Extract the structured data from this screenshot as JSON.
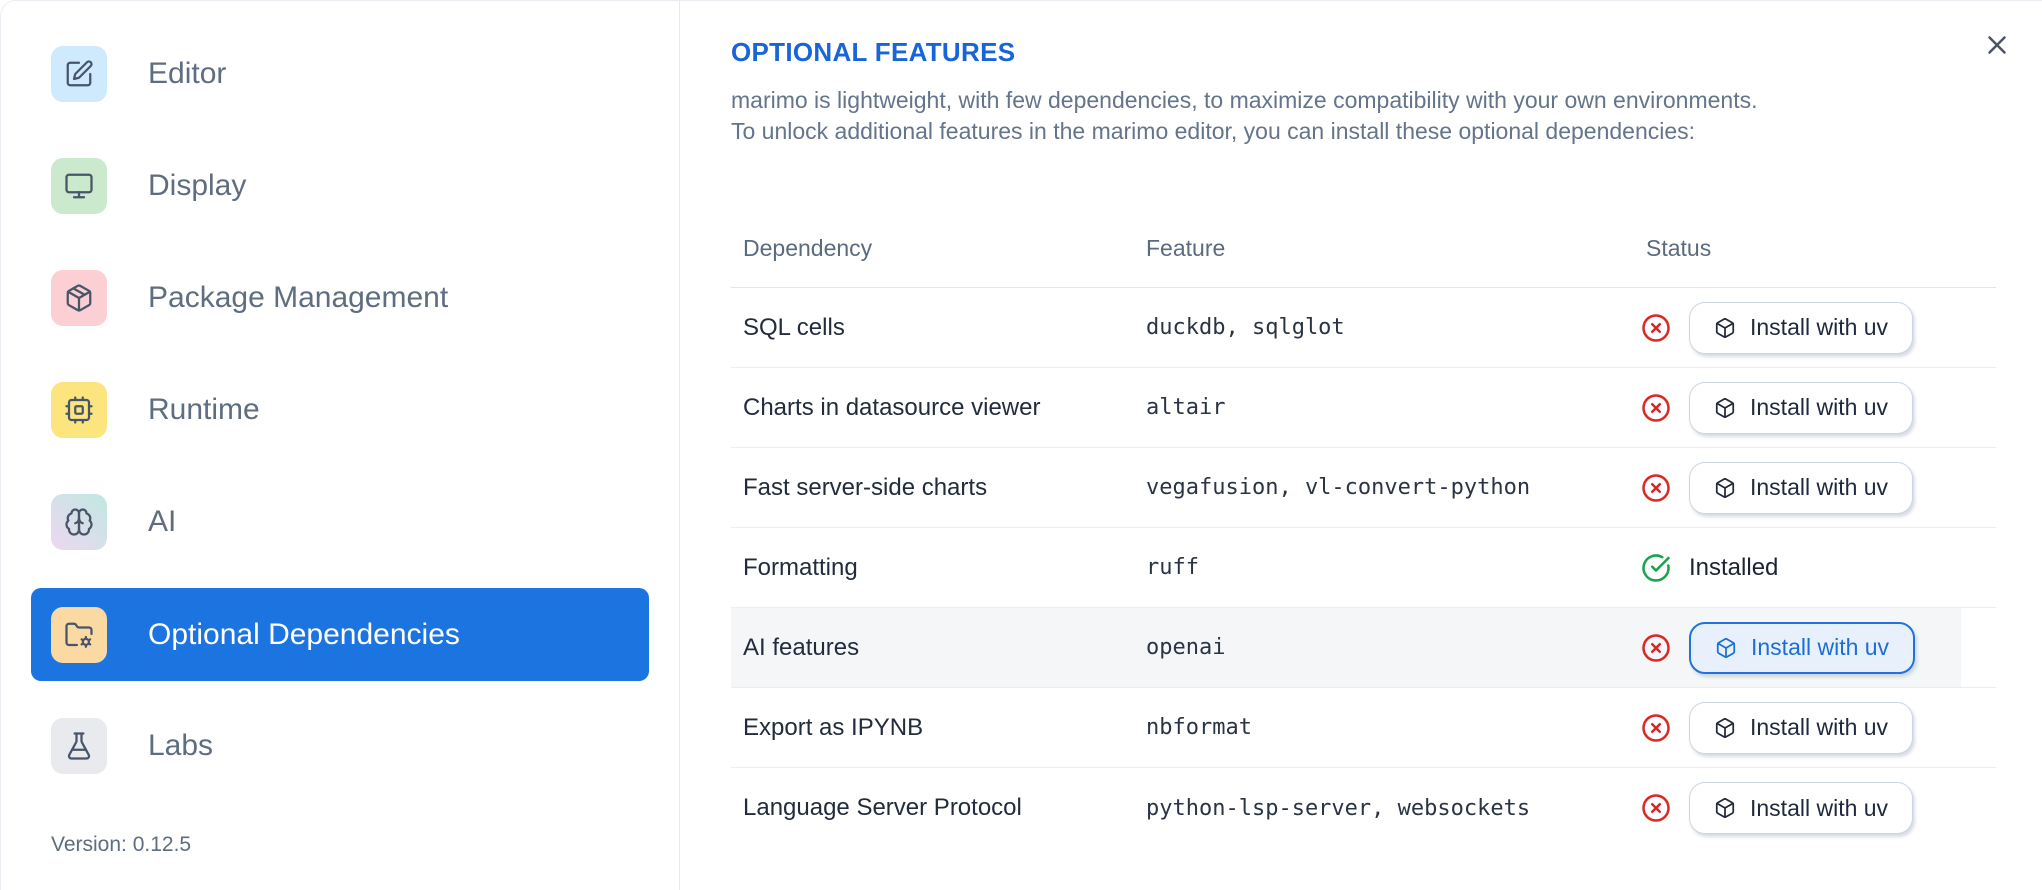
{
  "sidebar": {
    "items": [
      {
        "label": "Editor",
        "icon": "square-pen-icon",
        "tile_color": "#cfe9fd",
        "selected": false
      },
      {
        "label": "Display",
        "icon": "monitor-icon",
        "tile_color": "#cbe9cc",
        "selected": false
      },
      {
        "label": "Package Management",
        "icon": "package-icon",
        "tile_color": "#fbcfd3",
        "selected": false
      },
      {
        "label": "Runtime",
        "icon": "cpu-icon",
        "tile_color": "#fce47e",
        "selected": false
      },
      {
        "label": "AI",
        "icon": "brain-icon",
        "tile_color": "gradient(#eed7f2,#bfe8e0)",
        "selected": false
      },
      {
        "label": "Optional Dependencies",
        "icon": "folder-cog-icon",
        "tile_color": "#fbd9a2",
        "selected": true
      },
      {
        "label": "Labs",
        "icon": "flask-icon",
        "tile_color": "#e8eaed",
        "selected": false
      }
    ],
    "version": "Version: 0.12.5"
  },
  "panel": {
    "title": "OPTIONAL FEATURES",
    "description_lines": [
      "marimo is lightweight, with few dependencies, to maximize compatibility with your own environments.",
      "To unlock additional features in the marimo editor, you can install these optional dependencies:"
    ],
    "close_icon": "x-icon"
  },
  "table": {
    "columns": [
      "Dependency",
      "Feature",
      "Status"
    ],
    "install_button_label": "Install with uv",
    "installed_label": "Installed",
    "rows": [
      {
        "dependency": "SQL cells",
        "feature": "duckdb, sqlglot",
        "status": "missing",
        "highlighted": false
      },
      {
        "dependency": "Charts in datasource viewer",
        "feature": "altair",
        "status": "missing",
        "highlighted": false
      },
      {
        "dependency": "Fast server-side charts",
        "feature": "vegafusion, vl-convert-python",
        "status": "missing",
        "highlighted": false
      },
      {
        "dependency": "Formatting",
        "feature": "ruff",
        "status": "installed",
        "highlighted": false
      },
      {
        "dependency": "AI features",
        "feature": "openai",
        "status": "missing",
        "highlighted": true
      },
      {
        "dependency": "Export as IPYNB",
        "feature": "nbformat",
        "status": "missing",
        "highlighted": false
      },
      {
        "dependency": "Language Server Protocol",
        "feature": "python-lsp-server, websockets",
        "status": "missing",
        "highlighted": false
      }
    ]
  },
  "colors": {
    "selected_nav_bg": "#1b74e0",
    "title_blue": "#1765d8",
    "status_missing": "#dc2626",
    "status_installed": "#16a34a",
    "active_button_blue": "#2172dd",
    "row_highlight": "#f4f6f8"
  }
}
